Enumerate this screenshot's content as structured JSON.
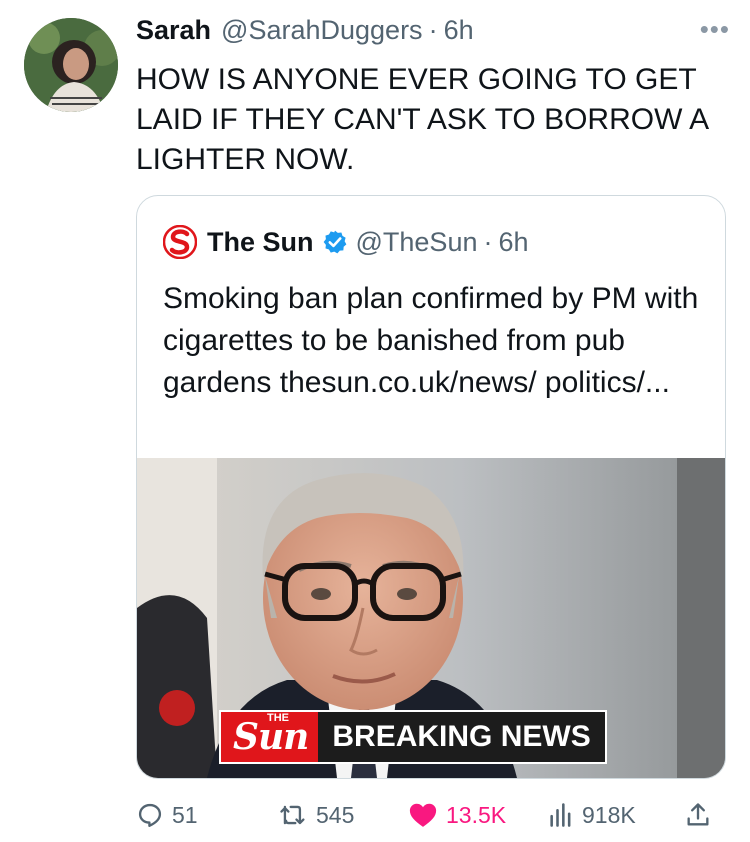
{
  "tweet": {
    "author_name": "Sarah",
    "author_handle": "@SarahDuggers",
    "separator": "·",
    "time": "6h",
    "more_icon": "more-dots-icon",
    "text": "HOW IS ANYONE EVER GOING TO GET LAID IF THEY CAN'T ASK TO BORROW A LIGHTER NOW."
  },
  "quoted": {
    "author_name": "The Sun",
    "author_handle": "@TheSun",
    "separator": "·",
    "time": "6h",
    "text": "Smoking ban plan confirmed by PM with cigarettes to be banished from pub gardens thesun.co.uk/news/ politics/...",
    "media": {
      "banner_brand": "Sun",
      "banner_brand_small": "THE",
      "banner_text": "BREAKING NEWS"
    }
  },
  "actions": {
    "replies": "51",
    "reposts": "545",
    "likes": "13.5K",
    "views": "918K"
  },
  "colors": {
    "like": "#f91880",
    "verified": "#1d9bf0",
    "sun_red": "#e0161b",
    "muted": "#536471"
  }
}
